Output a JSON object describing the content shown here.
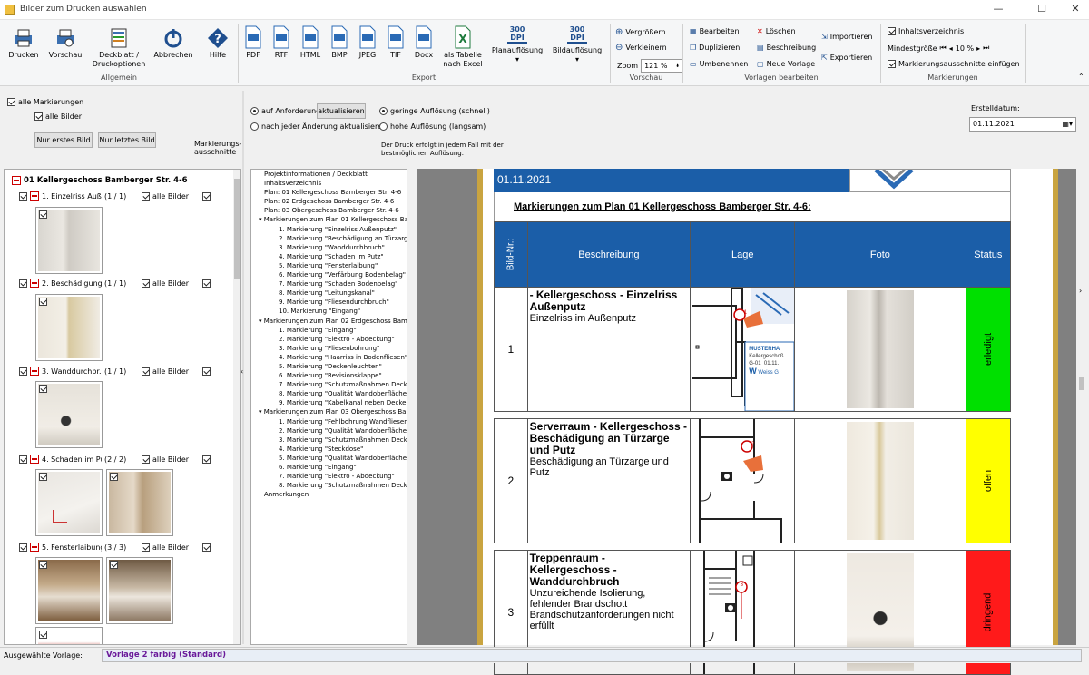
{
  "window": {
    "title": "Bilder zum Drucken auswählen"
  },
  "ribbon": {
    "drucken": "Drucken",
    "vorschau": "Vorschau",
    "deckblatt": "Deckblatt /",
    "deckblatt2": "Druckoptionen",
    "abbrechen": "Abbrechen",
    "hilfe": "Hilfe",
    "allgemein": "Allgemein",
    "pdf": "PDF",
    "rtf": "RTF",
    "html": "HTML",
    "bmp": "BMP",
    "jpeg": "JPEG",
    "tif": "TIF",
    "docx": "Docx",
    "tabelle": "als Tabelle",
    "tabelle2": "nach Excel",
    "dpi": "300",
    "dpi_unit": "DPI",
    "planaufl": "Planauflösung",
    "bildaufl": "Bildauflösung",
    "export": "Export",
    "vergroessern": "Vergrößern",
    "verkleinern": "Verkleinern",
    "zoom_label": "Zoom",
    "zoom_value": "121 %",
    "vorschau_grp": "Vorschau",
    "bearbeiten": "Bearbeiten",
    "duplizieren": "Duplizieren",
    "umbenennen": "Umbenennen",
    "loeschen": "Löschen",
    "beschreibung": "Beschreibung",
    "neue_vorlage": "Neue Vorlage",
    "importieren": "Importieren",
    "exportieren": "Exportieren",
    "vorlagen_grp": "Vorlagen bearbeiten",
    "inhaltsverzeichnis": "Inhaltsverzeichnis",
    "mindestgroesse": "Mindestgröße",
    "mindest_value": "10 %",
    "ausschnitte": "Markierungsausschnitte einfügen",
    "markierungen_grp": "Markierungen"
  },
  "options": {
    "alle_markierungen": "alle Markierungen",
    "alle_bilder": "alle Bilder",
    "nur_erstes": "Nur erstes Bild",
    "nur_letztes": "Nur letztes Bild",
    "markierungs": "Markierungs-",
    "ausschnitte": "ausschnitte",
    "auf_anforderung": "auf Anforderung",
    "aktualisieren": "aktualisieren",
    "nach_jeder": "nach jeder Änderung aktualisieren",
    "geringe": "geringe Auflösung (schnell)",
    "hohe": "hohe Auflösung (langsam)",
    "hinweis1": "Der Druck erfolgt in jedem Fall mit der",
    "hinweis2": "bestmöglichen Auflösung.",
    "erstelldatum_label": "Erstelldatum:",
    "erstelldatum": "01.11.2021"
  },
  "list": {
    "header": "01 Kellergeschoss Bamberger Str. 4-6",
    "items": [
      {
        "label": "1. Einzelriss Auß...",
        "count": "(1 / 1)",
        "all": "alle Bilder"
      },
      {
        "label": "2. Beschädigung...",
        "count": "(1 / 1)",
        "all": "alle Bilder"
      },
      {
        "label": "3. Wanddurchbr...",
        "count": "(1 / 1)",
        "all": "alle Bilder"
      },
      {
        "label": "4. Schaden im Putz",
        "count": "(2 / 2)",
        "all": "alle Bilder"
      },
      {
        "label": "5. Fensterlaibung",
        "count": "(3 / 3)",
        "all": "alle Bilder"
      }
    ]
  },
  "tree": [
    "Projektinformationen / Deckblatt",
    "Inhaltsverzeichnis",
    "Plan: 01 Kellergeschoss Bamberger Str. 4-6",
    "Plan: 02 Erdgeschoss Bamberger Str. 4-6",
    "Plan: 03 Obergeschoss Bamberger Str. 4-6",
    "Markierungen zum Plan 01 Kellergeschoss Ba",
    "1. Markierung \"Einzelriss Außenputz\"",
    "2. Markierung \"Beschädigung an Türzarge",
    "3. Markierung \"Wanddurchbruch\"",
    "4. Markierung \"Schaden im Putz\"",
    "5. Markierung \"Fensterlaibung\"",
    "6. Markierung \"Verfärbung Bodenbelag\"",
    "7. Markierung \"Schaden Bodenbelag\"",
    "8. Markierung \"Leitungskanal\"",
    "9. Markierung \"Fliesendurchbruch\"",
    "10. Markierung \"Eingang\"",
    "Markierungen zum Plan 02 Erdgeschoss Baml",
    "1. Markierung \"Eingang\"",
    "2. Markierung \"Elektro - Abdeckung\"",
    "3. Markierung \"Fliesenbohrung\"",
    "4. Markierung \"Haarriss in Bodenfliesen\"",
    "5. Markierung \"Deckenleuchten\"",
    "6. Markierung \"Revisionsklappe\"",
    "7. Markierung \"Schutzmaßnahmen Decke",
    "8. Markierung \"Qualität Wandoberfläche",
    "9. Markierung \"Kabelkanal neben Decken",
    "Markierungen zum Plan 03 Obergeschoss Ba",
    "1. Markierung \"Fehlbohrung Wandfliesen",
    "2. Markierung \"Qualität Wandoberfläche",
    "3. Markierung \"Schutzmaßnahmen Decke",
    "4. Markierung \"Steckdose\"",
    "5. Markierung \"Qualität Wandoberfläche",
    "6. Markierung \"Eingang\"",
    "7. Markierung \"Elektro - Abdeckung\"",
    "8. Markierung \"Schutzmaßnahmen Decke",
    "Anmerkungen"
  ],
  "report": {
    "date": "01.11.2021",
    "heading": "Markierungen zum Plan 01 Kellergeschoss Bamberger Str. 4-6:",
    "col_nr": "Bild-Nr.:",
    "col_desc": "Beschreibung",
    "col_lage": "Lage",
    "col_foto": "Foto",
    "col_status": "Status",
    "stamp_title": "MUSTERHA",
    "stamp_sub": "Kellergeschoß",
    "stamp_code": "G-01",
    "stamp_date": "01.11.",
    "stamp_w": "W",
    "stamp_name": "Weiss G",
    "rows": [
      {
        "nr": "1",
        "title": "- Kellergeschoss - Einzelriss Außenputz",
        "desc": "Einzelriss im Außenputz",
        "status": "erledigt",
        "color": "#00e000",
        "marker": "1"
      },
      {
        "nr": "2",
        "title": "Serverraum - Kellergeschoss - Beschädigung an Türzarge und Putz",
        "desc": "Beschädigung an Türzarge und Putz",
        "status": "offen",
        "color": "#ffff00",
        "marker": "2"
      },
      {
        "nr": "3",
        "title": "Treppenraum - Kellergeschoss - Wanddurchbruch",
        "desc": "Unzureichende Isolierung, fehlender Brandschott Brandschutzanforderungen nicht erfüllt",
        "status": "dringend",
        "color": "#ff1a1a",
        "marker": "3"
      }
    ]
  },
  "status": {
    "label": "Ausgewählte Vorlage:",
    "value": "Vorlage 2 farbig (Standard)"
  }
}
